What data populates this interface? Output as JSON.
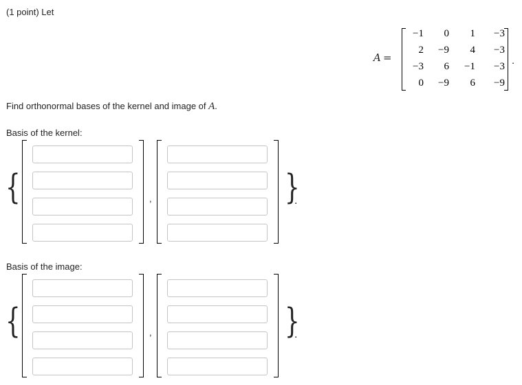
{
  "problem": {
    "header": "(1 point) Let",
    "question_prefix": "Find orthonormal bases of the kernel and image of ",
    "question_math": "A",
    "question_suffix": "."
  },
  "matrix": {
    "name": "A",
    "equals": "=",
    "rows": [
      [
        "−1",
        "0",
        "1",
        "−3"
      ],
      [
        "2",
        "−9",
        "4",
        "−3"
      ],
      [
        "−3",
        "6",
        "−1",
        "−3"
      ],
      [
        "0",
        "−9",
        "6",
        "−9"
      ]
    ],
    "trailing": "."
  },
  "kernel": {
    "label": "Basis of the kernel:",
    "vectors": [
      {
        "entries": [
          "",
          "",
          "",
          ""
        ]
      },
      {
        "entries": [
          "",
          "",
          "",
          ""
        ]
      }
    ]
  },
  "image": {
    "label": "Basis of the image:",
    "vectors": [
      {
        "entries": [
          "",
          "",
          "",
          ""
        ]
      },
      {
        "entries": [
          "",
          "",
          "",
          ""
        ]
      }
    ]
  },
  "symbols": {
    "open_brace": "{",
    "close_brace": "}",
    "comma": ",",
    "period": "."
  }
}
